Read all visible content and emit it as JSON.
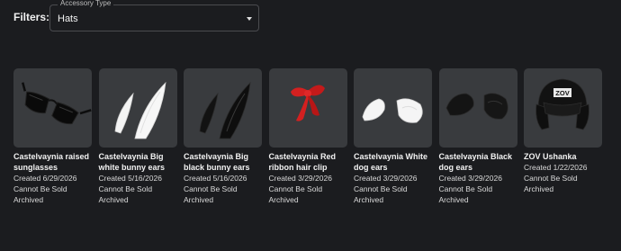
{
  "filters": {
    "label": "Filters:",
    "accessory_type": {
      "legend": "Accessory Type",
      "value": "Hats"
    }
  },
  "items": [
    {
      "name": "Castelvaynia raised sunglasses",
      "created": "Created 6/29/2026",
      "sale_status": "Cannot Be Sold",
      "state": "Archived",
      "thumbnail_icon": "sunglasses-icon"
    },
    {
      "name": "Castelvaynia Big white bunny ears",
      "created": "Created 5/16/2026",
      "sale_status": "Cannot Be Sold",
      "state": "Archived",
      "thumbnail_icon": "white-bunny-ears-icon"
    },
    {
      "name": "Castelvaynia Big black bunny ears",
      "created": "Created 5/16/2026",
      "sale_status": "Cannot Be Sold",
      "state": "Archived",
      "thumbnail_icon": "black-bunny-ears-icon"
    },
    {
      "name": "Castelvaynia Red ribbon hair clip",
      "created": "Created 3/29/2026",
      "sale_status": "Cannot Be Sold",
      "state": "Archived",
      "thumbnail_icon": "red-ribbon-icon"
    },
    {
      "name": "Castelvaynia White dog ears",
      "created": "Created 3/29/2026",
      "sale_status": "Cannot Be Sold",
      "state": "Archived",
      "thumbnail_icon": "white-dog-ears-icon"
    },
    {
      "name": "Castelvaynia Black dog ears",
      "created": "Created 3/29/2026",
      "sale_status": "Cannot Be Sold",
      "state": "Archived",
      "thumbnail_icon": "black-dog-ears-icon"
    },
    {
      "name": "ZOV Ushanka",
      "created": "Created 1/22/2026",
      "sale_status": "Cannot Be Sold",
      "state": "Archived",
      "thumbnail_icon": "ushanka-hat-icon",
      "hat_badge_text": "ZOV"
    }
  ],
  "colors": {
    "background": "#1b1c1f",
    "card_background": "#393b3e",
    "ribbon_red": "#d42020"
  }
}
